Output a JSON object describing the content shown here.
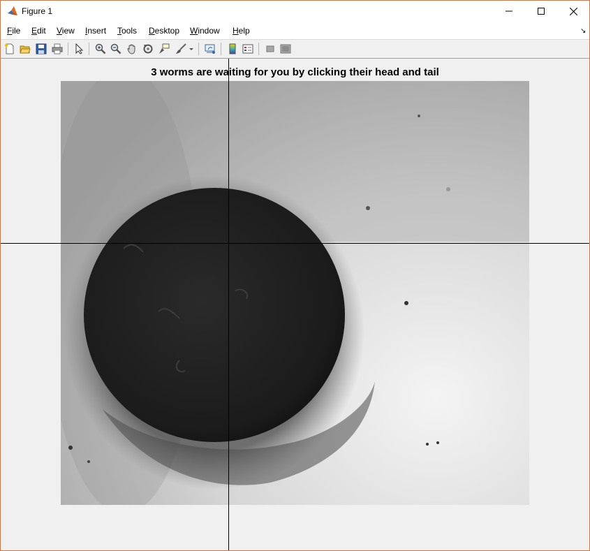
{
  "window": {
    "title": "Figure 1",
    "controls": [
      "minimize",
      "maximize",
      "close"
    ]
  },
  "menu": {
    "items": [
      "File",
      "Edit",
      "View",
      "Insert",
      "Tools",
      "Desktop",
      "Window",
      "Help"
    ]
  },
  "toolbar": {
    "buttons": [
      "new-figure-icon",
      "open-file-icon",
      "save-icon",
      "print-icon",
      "pointer-icon",
      "zoom-in-icon",
      "zoom-out-icon",
      "pan-icon",
      "rotate-3d-icon",
      "data-cursor-icon",
      "brush-icon",
      "link-plot-icon",
      "colorbar-icon",
      "legend-icon",
      "hide-plot-tools-icon",
      "show-plot-tools-icon"
    ]
  },
  "figure": {
    "title": "3 worms are waiting for you by clicking their head and tail",
    "image": {
      "description_icon": "grayscale-microscopy-image",
      "background_color": "#d6d6d6",
      "blob_color": "#1c1c1c"
    }
  },
  "colors": {
    "window_border": "#c77a52",
    "figure_background": "#f0f0f0",
    "crosshair": "#000000"
  }
}
